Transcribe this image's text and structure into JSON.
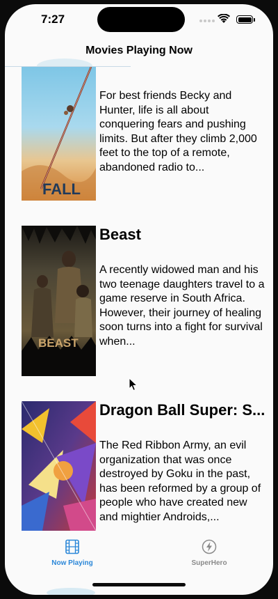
{
  "status": {
    "time": "7:27"
  },
  "nav": {
    "title": "Movies Playing Now"
  },
  "movies": [
    {
      "title": "",
      "poster_text": "FALL",
      "overview": "For best friends Becky and Hunter, life is all about conquering fears and pushing limits. But after they climb 2,000 feet to the top of a remote, abandoned radio to..."
    },
    {
      "title": "Beast",
      "poster_text": "BEAST",
      "overview": "A recently widowed man and his two teenage daughters travel to a game reserve in South Africa. However, their journey of healing soon turns into a fight for survival when..."
    },
    {
      "title": "Dragon Ball Super: S...",
      "poster_text": "",
      "overview": "The Red Ribbon Army, an evil organization that was once destroyed by Goku in the past, has been reformed by a group of people who have created new and mightier Androids,..."
    }
  ],
  "tabs": [
    {
      "label": "Now Playing",
      "icon": "film-icon",
      "active": true,
      "color": "#2b87d8"
    },
    {
      "label": "SuperHero",
      "icon": "bolt-icon",
      "active": false,
      "color": "#8a8a8a"
    }
  ]
}
